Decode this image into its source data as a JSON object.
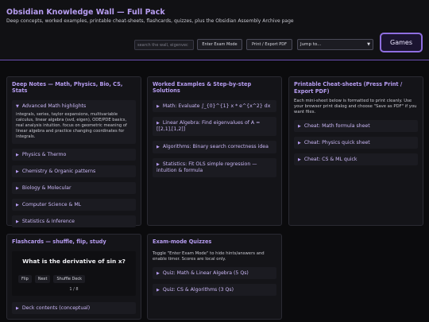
{
  "header": {
    "title": "Obsidian Knowledge Wall — Full Pack",
    "subtitle": "Deep concepts, worked examples, printable cheat-sheets, flashcards, quizzes, plus the Obsidian Assembly Archive page",
    "search_placeholder": "search the wall, eigenvec",
    "exam_mode_label": "Enter Exam Mode",
    "print_label": "Print / Export PDF",
    "jump_label": "Jump to...",
    "games_label": "Games"
  },
  "deep_notes": {
    "title": "Deep Notes — Math, Physics, Bio, CS, Stats",
    "open_item": {
      "label": "Advanced Math highlights",
      "body": "integrals, series, taylor expansions, multivariable calculus, linear algebra (svd, eigen), ODE/PDE basics, real analysis intuition. focus on geometric meaning of linear algebra and practice changing coordinates for integrals."
    },
    "items": [
      {
        "label": "Physics & Thermo"
      },
      {
        "label": "Chemistry & Organic patterns"
      },
      {
        "label": "Biology & Molecular"
      },
      {
        "label": "Computer Science & ML"
      },
      {
        "label": "Statistics & Inference"
      }
    ]
  },
  "worked_examples": {
    "title": "Worked Examples & Step-by-step Solutions",
    "items": [
      {
        "label": "Math: Evaluate ∫_{0}^{1} x * e^{x^2} dx"
      },
      {
        "label": "Linear Algebra: Find eigenvalues of A = [[2,1],[1,2]]"
      },
      {
        "label": "Algorithms: Binary search correctness idea"
      },
      {
        "label": "Statistics: Fit OLS simple regression — intuition & formula"
      }
    ]
  },
  "cheatsheets": {
    "title": "Printable Cheat-sheets (Press Print / Export PDF)",
    "description": "Each mini-sheet below is formatted to print cleanly. Use your browser print dialog and choose \"Save as PDF\" if you want files.",
    "items": [
      {
        "label": "Cheat: Math formula sheet"
      },
      {
        "label": "Cheat: Physics quick sheet"
      },
      {
        "label": "Cheat: CS & ML quick"
      }
    ]
  },
  "flashcards": {
    "title": "Flashcards — shuffle, flip, study",
    "question": "What is the derivative of sin x?",
    "flip_label": "Flip",
    "next_label": "Next",
    "shuffle_label": "Shuffle Deck",
    "counter": "1 / 8",
    "deck_label": "Deck contents (conceptual)"
  },
  "quizzes": {
    "title": "Exam-mode Quizzes",
    "description": "Toggle \"Enter Exam Mode\" to hide hints/answers and enable timer. Scores are local only.",
    "items": [
      {
        "label": "Quiz: Math & Linear Algebra (5 Qs)"
      },
      {
        "label": "Quiz: CS & Algorithms (3 Qs)"
      }
    ]
  },
  "icons": {
    "collapsed": "triangle-right-icon",
    "expanded": "triangle-down-icon"
  },
  "colors": {
    "accent": "#b69cf0",
    "background": "#0b0b0d",
    "panel": "#141418"
  }
}
